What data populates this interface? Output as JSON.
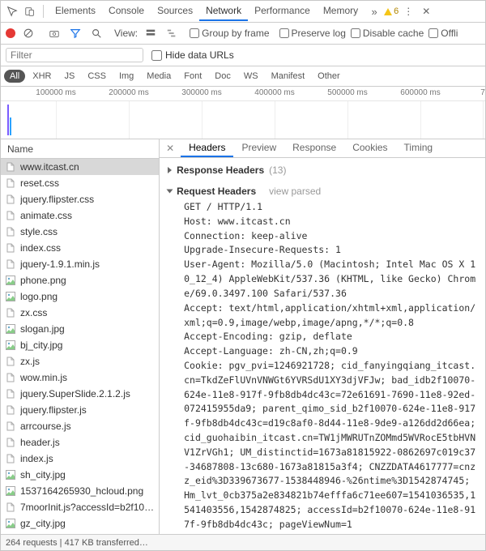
{
  "main_tabs": [
    "Elements",
    "Console",
    "Sources",
    "Network",
    "Performance",
    "Memory"
  ],
  "main_tab_active": 3,
  "overflow_glyph": "»",
  "warning_count": "6",
  "row2": {
    "view_label": "View:",
    "group_by_frame": "Group by frame",
    "preserve_log": "Preserve log",
    "disable_cache": "Disable cache",
    "offline": "Offli"
  },
  "filter": {
    "placeholder": "Filter",
    "hide_data_urls": "Hide data URLs"
  },
  "type_chips": [
    "All",
    "XHR",
    "JS",
    "CSS",
    "Img",
    "Media",
    "Font",
    "Doc",
    "WS",
    "Manifest",
    "Other"
  ],
  "type_chip_active": 0,
  "timeline_ticks": [
    "100000 ms",
    "200000 ms",
    "300000 ms",
    "400000 ms",
    "500000 ms",
    "600000 ms",
    "7"
  ],
  "name_header": "Name",
  "files": [
    {
      "name": "www.itcast.cn",
      "icon": "doc",
      "selected": true
    },
    {
      "name": "reset.css",
      "icon": "css"
    },
    {
      "name": "jquery.flipster.css",
      "icon": "css"
    },
    {
      "name": "animate.css",
      "icon": "css"
    },
    {
      "name": "style.css",
      "icon": "css"
    },
    {
      "name": "index.css",
      "icon": "css"
    },
    {
      "name": "jquery-1.9.1.min.js",
      "icon": "js"
    },
    {
      "name": "phone.png",
      "icon": "img"
    },
    {
      "name": "logo.png",
      "icon": "img"
    },
    {
      "name": "zx.css",
      "icon": "css"
    },
    {
      "name": "slogan.jpg",
      "icon": "img"
    },
    {
      "name": "bj_city.jpg",
      "icon": "img"
    },
    {
      "name": "zx.js",
      "icon": "js"
    },
    {
      "name": "wow.min.js",
      "icon": "js"
    },
    {
      "name": "jquery.SuperSlide.2.1.2.js",
      "icon": "js"
    },
    {
      "name": "jquery.flipster.js",
      "icon": "js"
    },
    {
      "name": "arrcourse.js",
      "icon": "js"
    },
    {
      "name": "header.js",
      "icon": "js"
    },
    {
      "name": "index.js",
      "icon": "js"
    },
    {
      "name": "sh_city.jpg",
      "icon": "img"
    },
    {
      "name": "1537164265930_hcloud.png",
      "icon": "img"
    },
    {
      "name": "7moorInit.js?accessId=b2f10…",
      "icon": "js"
    },
    {
      "name": "gz_city.jpg",
      "icon": "img"
    }
  ],
  "detail_tabs": [
    "Headers",
    "Preview",
    "Response",
    "Cookies",
    "Timing"
  ],
  "detail_tab_active": 0,
  "response_headers": {
    "title": "Response Headers",
    "count": "(13)"
  },
  "request_headers": {
    "title": "Request Headers",
    "sub": "view parsed"
  },
  "raw_headers": "GET / HTTP/1.1\nHost: www.itcast.cn\nConnection: keep-alive\nUpgrade-Insecure-Requests: 1\nUser-Agent: Mozilla/5.0 (Macintosh; Intel Mac OS X 10_12_4) AppleWebKit/537.36 (KHTML, like Gecko) Chrome/69.0.3497.100 Safari/537.36\nAccept: text/html,application/xhtml+xml,application/xml;q=0.9,image/webp,image/apng,*/*;q=0.8\nAccept-Encoding: gzip, deflate\nAccept-Language: zh-CN,zh;q=0.9\nCookie: pgv_pvi=1246921728; cid_fanyingqiang_itcast.cn=TkdZeFlUVnVNWGt6YVRSdU1XY3djVFJw; bad_idb2f10070-624e-11e8-917f-9fb8db4dc43c=72e61691-7690-11e8-92ed-072415955da9; parent_qimo_sid_b2f10070-624e-11e8-917f-9fb8db4dc43c=d19c8af0-8d44-11e8-9de9-a126dd2d66ea; cid_guohaibin_itcast.cn=TW1jMWRUTnZOMmd5WVRocE5tbHVNV1ZrVGh1; UM_distinctid=1673a81815922-0862697c019c37-34687808-13c680-1673a81815a3f4; CNZZDATA4617777=cnzz_eid%3D339673677-1538448946-%26ntime%3D1542874745; Hm_lvt_0cb375a2e834821b74efffa6c71ee607=1541036535,1541403556,1542874825; accessId=b2f10070-624e-11e8-917f-9fb8db4dc43c; pageViewNum=1",
  "statusbar": "264 requests | 417 KB transferred…",
  "colors": {
    "accent": "#1a73e8",
    "record": "#e53935"
  }
}
